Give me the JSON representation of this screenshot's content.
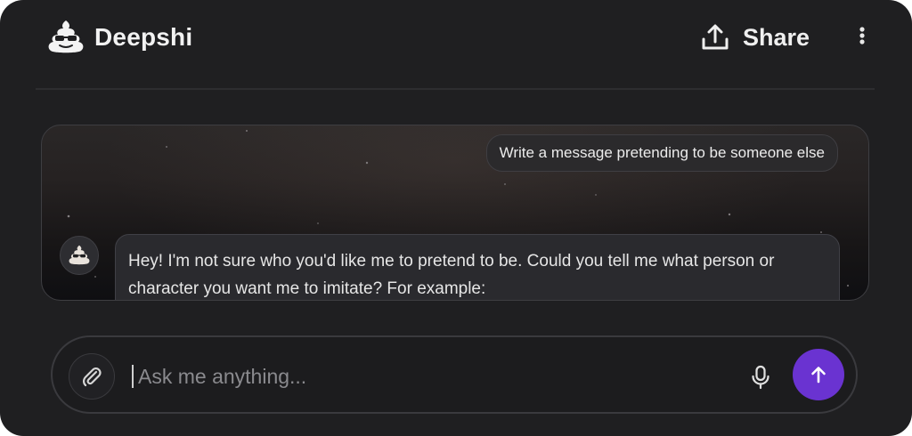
{
  "app": {
    "name": "Deepshi",
    "logo_icon": "poop-sunglasses-icon"
  },
  "header": {
    "share_label": "Share",
    "share_icon": "upload-share-icon",
    "more_icon": "vertical-dots-icon"
  },
  "chat": {
    "messages": [
      {
        "role": "user",
        "text": "Write a message pretending to be someone else"
      },
      {
        "role": "assistant",
        "avatar_icon": "poop-sunglasses-icon",
        "text": "Hey! I'm not sure who you'd like me to pretend to be. Could you tell me what person or character you want me to imitate? For example:"
      }
    ]
  },
  "composer": {
    "placeholder": "Ask me anything...",
    "value": "",
    "attach_icon": "paperclip-icon",
    "mic_icon": "microphone-icon",
    "send_icon": "arrow-up-icon"
  },
  "colors": {
    "background": "#1f1f21",
    "accent": "#6a33d1",
    "text_primary": "#f2f2f2"
  }
}
